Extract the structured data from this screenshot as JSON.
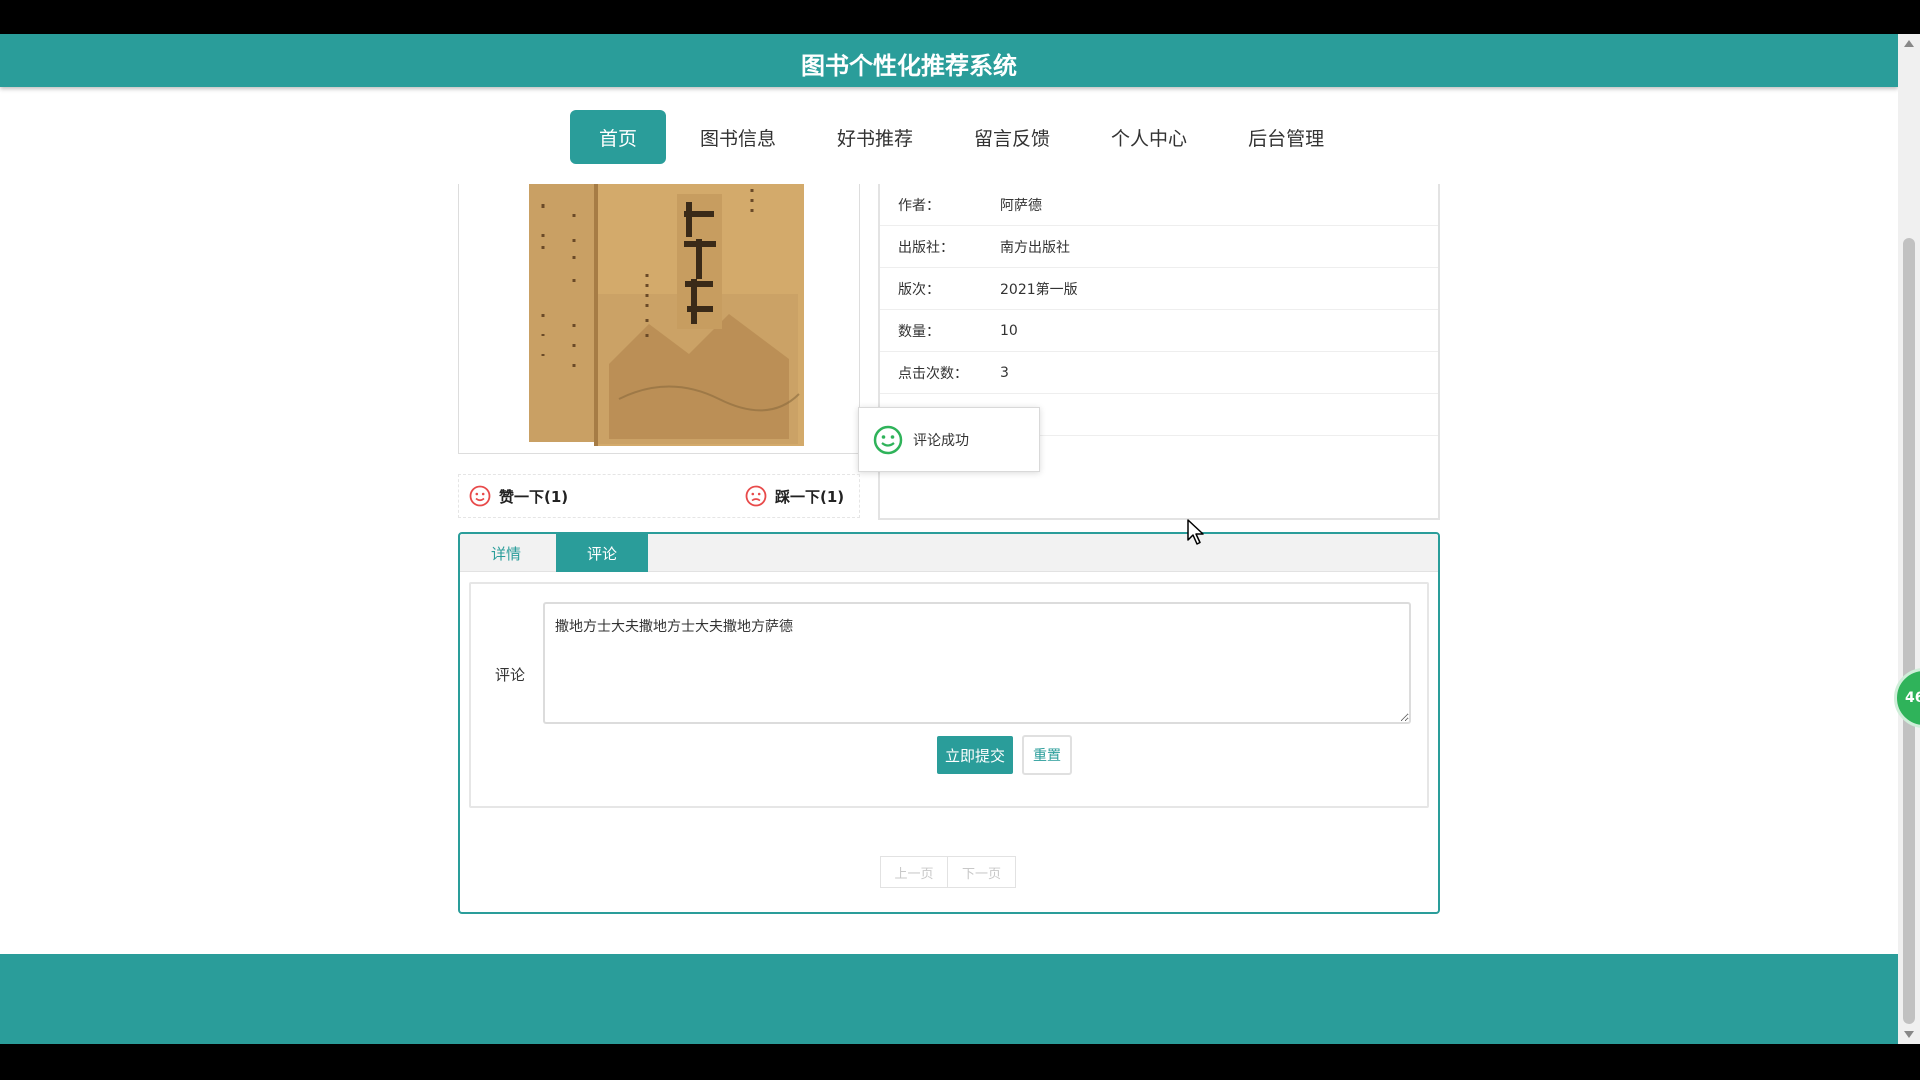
{
  "header": {
    "site_title": "图书个性化推荐系统"
  },
  "nav": {
    "items": [
      {
        "label": "首页",
        "active": true
      },
      {
        "label": "图书信息"
      },
      {
        "label": "好书推荐"
      },
      {
        "label": "留言反馈"
      },
      {
        "label": "个人中心"
      },
      {
        "label": "后台管理"
      }
    ]
  },
  "book_info": {
    "rows": [
      {
        "label": "作者：",
        "value": "阿萨德"
      },
      {
        "label": "出版社：",
        "value": "南方出版社"
      },
      {
        "label": "版次：",
        "value": "2021第一版"
      },
      {
        "label": "数量：",
        "value": "10"
      },
      {
        "label": "点击次数：",
        "value": "3"
      }
    ]
  },
  "toast": {
    "message": "评论成功"
  },
  "votes": {
    "like_label": "赞一下(1)",
    "dislike_label": "踩一下(1)"
  },
  "tabs": {
    "detail": "详情",
    "comment": "评论"
  },
  "comment_form": {
    "label": "评论",
    "value": "撒地方士大夫撒地方士大夫撒地方萨德",
    "submit_label": "立即提交",
    "reset_label": "重置"
  },
  "pager": {
    "prev": "上一页",
    "next": "下一页"
  },
  "floating_badge": {
    "text": "46"
  },
  "colors": {
    "primary": "#2a9d9a",
    "toast_icon": "#2fb35a",
    "vote_icon": "#e84a4a"
  }
}
